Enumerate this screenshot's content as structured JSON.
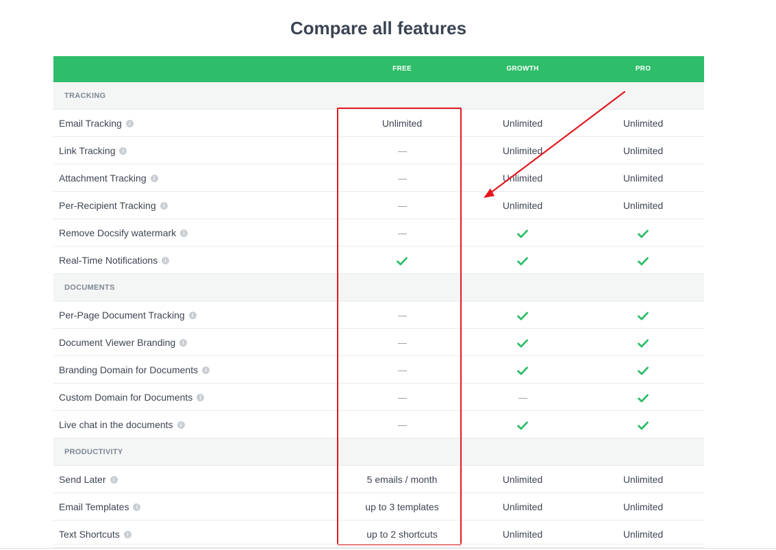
{
  "page_title": "Compare all features",
  "columns": [
    "FREE",
    "GROWTH",
    "PRO"
  ],
  "sections": [
    {
      "label": "TRACKING",
      "rows": [
        {
          "name": "Email Tracking",
          "values": [
            "Unlimited",
            "Unlimited",
            "Unlimited"
          ]
        },
        {
          "name": "Link Tracking",
          "values": [
            "dash",
            "Unlimited",
            "Unlimited"
          ]
        },
        {
          "name": "Attachment Tracking",
          "values": [
            "dash",
            "Unlimited",
            "Unlimited"
          ]
        },
        {
          "name": "Per-Recipient Tracking",
          "values": [
            "dash",
            "Unlimited",
            "Unlimited"
          ]
        },
        {
          "name": "Remove Docsify watermark",
          "values": [
            "dash",
            "check",
            "check"
          ]
        },
        {
          "name": "Real-Time Notifications",
          "values": [
            "check",
            "check",
            "check"
          ]
        }
      ]
    },
    {
      "label": "DOCUMENTS",
      "rows": [
        {
          "name": "Per-Page Document Tracking",
          "values": [
            "dash",
            "check",
            "check"
          ]
        },
        {
          "name": "Document Viewer Branding",
          "values": [
            "dash",
            "check",
            "check"
          ]
        },
        {
          "name": "Branding Domain for Documents",
          "values": [
            "dash",
            "check",
            "check"
          ]
        },
        {
          "name": "Custom Domain for Documents",
          "values": [
            "dash",
            "dash",
            "check"
          ]
        },
        {
          "name": "Live chat in the documents",
          "values": [
            "dash",
            "check",
            "check"
          ]
        }
      ]
    },
    {
      "label": "PRODUCTIVITY",
      "rows": [
        {
          "name": "Send Later",
          "values": [
            "5 emails / month",
            "Unlimited",
            "Unlimited"
          ]
        },
        {
          "name": "Email Templates",
          "values": [
            "up to 3 templates",
            "Unlimited",
            "Unlimited"
          ]
        },
        {
          "name": "Text Shortcuts",
          "values": [
            "up to 2 shortcuts",
            "Unlimited",
            "Unlimited"
          ]
        }
      ]
    }
  ],
  "icons": {
    "info": "info-icon",
    "check": "check-icon",
    "dash": "dash-icon"
  },
  "colors": {
    "header_green": "#2ebd69",
    "check_green": "#2ebd69",
    "annotation_red": "#e3161d",
    "section_bg": "#f4f5f5"
  }
}
